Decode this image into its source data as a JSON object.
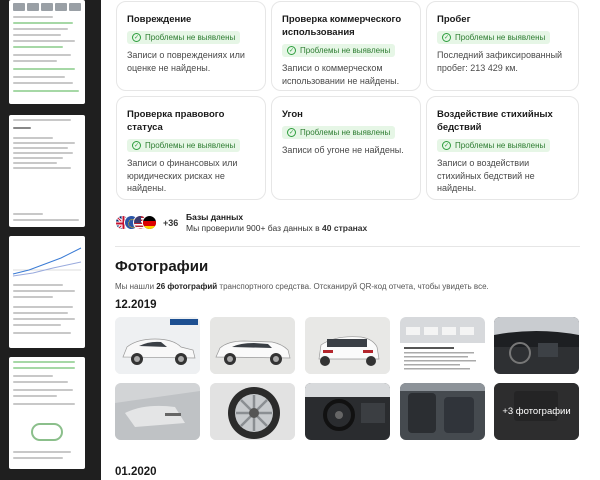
{
  "checks": [
    {
      "title": "Повреждение",
      "badge": "Проблемы не выявлены",
      "text": "Записи о повреждениях или оценке не найдены."
    },
    {
      "title": "Проверка коммерческого использования",
      "badge": "Проблемы не выявлены",
      "text": "Записи о коммерческом использовании не найдены."
    },
    {
      "title": "Пробег",
      "badge": "Проблемы не выявлены",
      "text": "Последний зафиксированный пробег: 213 429 км."
    },
    {
      "title": "Проверка правового статуса",
      "badge": "Проблемы не выявлены",
      "text": "Записи о финансовых или юридических рисках не найдены."
    },
    {
      "title": "Угон",
      "badge": "Проблемы не выявлены",
      "text": "Записи об угоне не найдены."
    },
    {
      "title": "Воздействие стихийных бедствий",
      "badge": "Проблемы не выявлены",
      "text": "Записи о воздействии стихийных бедствий не найдены."
    }
  ],
  "databases": {
    "extra_count": "+36",
    "title": "Базы данных",
    "desc_prefix": "Мы проверили 900+ баз данных в ",
    "desc_bold": "40 странах",
    "flags": [
      "uk-flag",
      "eu-flag",
      "us-flag",
      "de-flag"
    ]
  },
  "photos": {
    "heading": "Фотографии",
    "sub_prefix": "Мы нашли ",
    "sub_bold": "26 фотографий",
    "sub_suffix": " транспортного средства. Отсканируй QR-код отчета, чтобы увидеть все.",
    "groups": [
      {
        "date": "12.2019",
        "more_label": "+3 фотографии"
      },
      {
        "date": "01.2020"
      }
    ]
  },
  "colors": {
    "badge_bg": "#e6f6e6",
    "badge_text": "#2e7d32",
    "sidebar_bg": "#1f1f1f"
  }
}
